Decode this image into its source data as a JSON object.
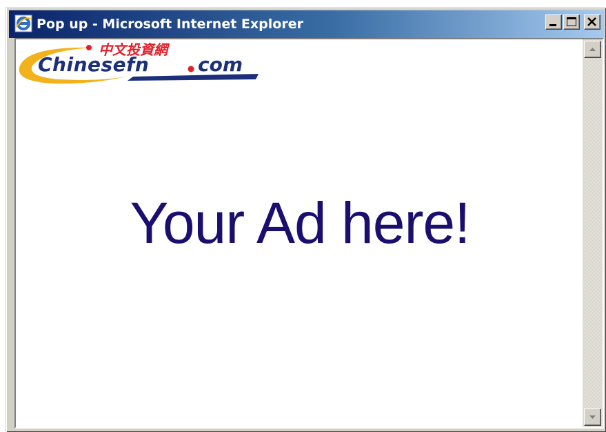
{
  "window": {
    "title": "Pop up - Microsoft Internet Explorer",
    "icon": "internet-explorer-icon",
    "controls": {
      "minimize": "minimize-icon",
      "maximize": "maximize-icon",
      "close": "close-icon"
    }
  },
  "page": {
    "logo": {
      "chinese": "中文投資網",
      "brand_main": "Chinesefn",
      "brand_tld": "com",
      "colors": {
        "red": "#e3202a",
        "navy": "#1c2f7a",
        "swoosh": "#f2b21b"
      }
    },
    "ad_text": "Your Ad here!",
    "ad_color": "#1a0f6e"
  },
  "scrollbar": {
    "up": "scroll-up-arrow-icon",
    "down": "scroll-down-arrow-icon"
  },
  "colors": {
    "titlebar_start": "#0a246a",
    "titlebar_end": "#a6caf0",
    "chrome": "#d4d0c8"
  }
}
